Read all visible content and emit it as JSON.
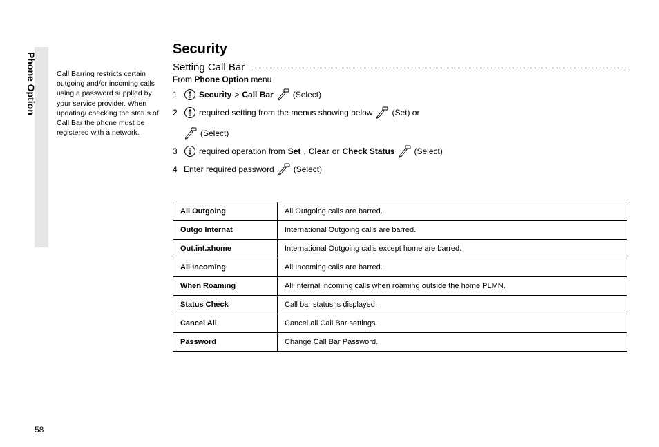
{
  "sideTab": "Phone Option",
  "sidebarNote": "Call Barring restricts certain outgoing and/or incoming calls using a password supplied by your service provider. When updating/\nchecking the status of Call Bar the phone must be registered with a network.",
  "title": "Security",
  "subheading": "Setting Call Bar",
  "fromLine": {
    "pre": "From ",
    "bold": "Phone Option",
    "post": " menu"
  },
  "steps": {
    "s1": {
      "num": "1",
      "bold1": "Security",
      "gt": ">",
      "bold2": "Call Bar",
      "tail": "(Select)"
    },
    "s2": {
      "num": "2",
      "mid": "required setting from the menus showing below",
      "set": "(Set) or",
      "select": "(Select)"
    },
    "s3": {
      "num": "3",
      "mid": "required operation from ",
      "b1": "Set",
      "c1": ", ",
      "b2": "Clear",
      "c2": " or ",
      "b3": "Check Status",
      "tail": "(Select)"
    },
    "s4": {
      "num": "4",
      "mid": "Enter required password",
      "tail": "(Select)"
    }
  },
  "table": [
    {
      "name": "All Outgoing",
      "desc": "All Outgoing calls are barred."
    },
    {
      "name": "Outgo Internat",
      "desc": "International Outgoing calls are barred."
    },
    {
      "name": "Out.int.xhome",
      "desc": "International Outgoing calls except home are barred."
    },
    {
      "name": "All Incoming",
      "desc": "All Incoming calls are barred."
    },
    {
      "name": "When Roaming",
      "desc": "All internal incoming calls when roaming outside the home PLMN."
    },
    {
      "name": "Status Check",
      "desc": "Call bar status is displayed."
    },
    {
      "name": "Cancel All",
      "desc": "Cancel all Call Bar settings."
    },
    {
      "name": "Password",
      "desc": "Change Call Bar Password."
    }
  ],
  "pageNumber": "58"
}
